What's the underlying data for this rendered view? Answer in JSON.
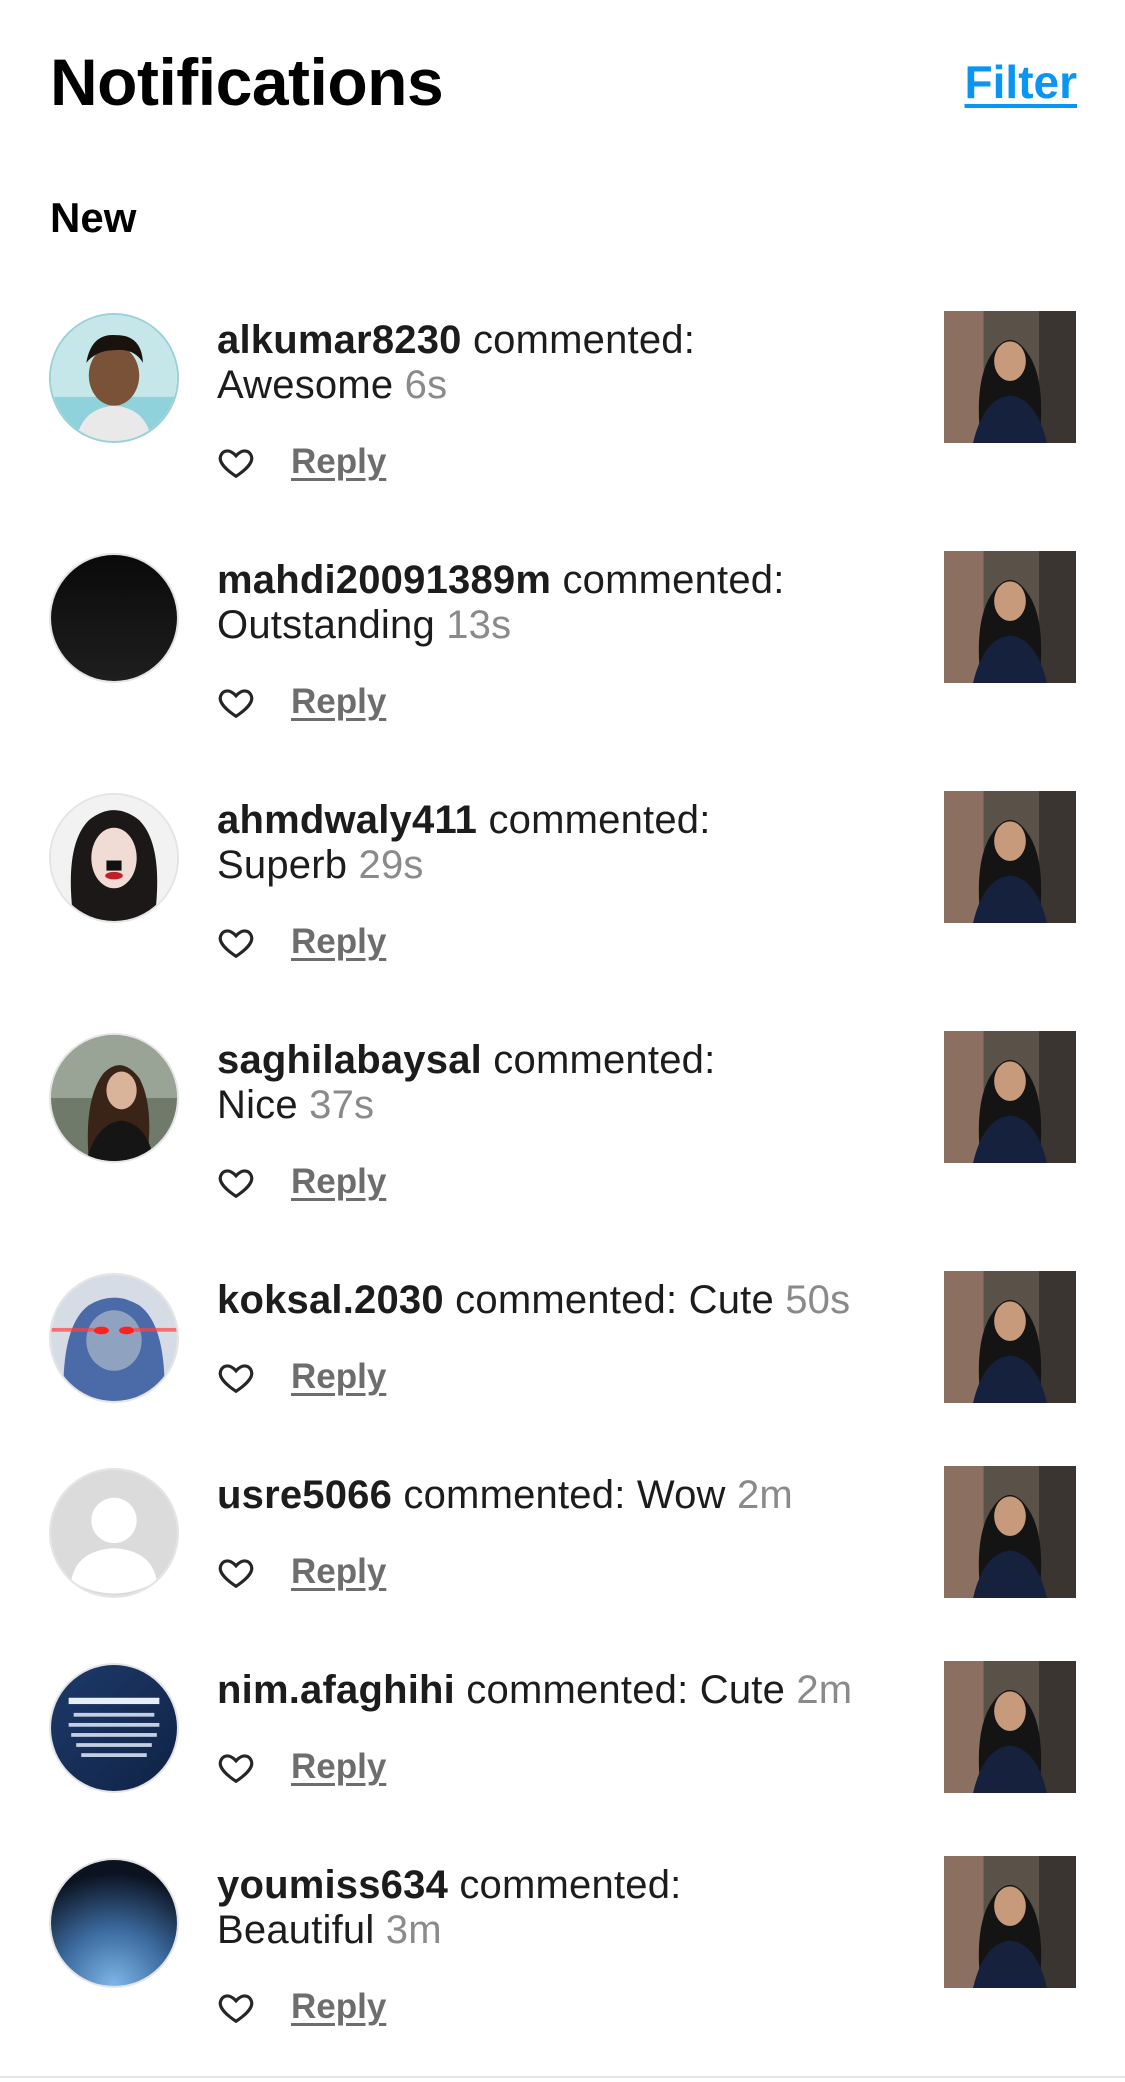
{
  "header": {
    "title": "Notifications",
    "filter_label": "Filter"
  },
  "section": {
    "label": "New"
  },
  "reply_label": "Reply",
  "notifications": [
    {
      "username": "alkumar8230",
      "action": "commented:",
      "comment": "Awesome",
      "time": "6s",
      "avatar_icon": "profile-photo-boy"
    },
    {
      "username": "mahdi20091389m",
      "action": "commented:",
      "comment": "Outstanding",
      "time": "13s",
      "avatar_icon": "profile-photo-black"
    },
    {
      "username": "ahmdwaly411",
      "action": "commented:",
      "comment": "Superb",
      "time": "29s",
      "avatar_icon": "profile-photo-girl"
    },
    {
      "username": "saghilabaysal",
      "action": "commented:",
      "comment": "Nice",
      "time": "37s",
      "avatar_icon": "profile-photo-woman"
    },
    {
      "username": "koksal.2030",
      "action": "commented:",
      "comment": "Cute",
      "time": "50s",
      "avatar_icon": "profile-photo-hoodie"
    },
    {
      "username": "usre5066",
      "action": "commented:",
      "comment": "Wow",
      "time": "2m",
      "avatar_icon": "default-avatar-icon"
    },
    {
      "username": "nim.afaghihi",
      "action": "commented:",
      "comment": "Cute",
      "time": "2m",
      "avatar_icon": "profile-photo-text"
    },
    {
      "username": "youmiss634",
      "action": "commented:",
      "comment": "Beautiful",
      "time": "3m",
      "avatar_icon": "profile-photo-gradient"
    }
  ],
  "colors": {
    "accent": "#0a95f5",
    "time_gray": "#8a8a8a",
    "reply_gray": "#6d6d6d"
  }
}
